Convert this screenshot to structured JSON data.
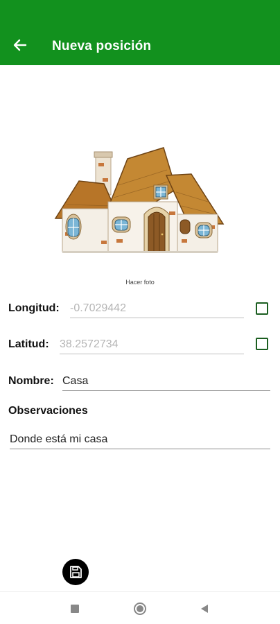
{
  "toolbar": {
    "title": "Nueva posición",
    "back_icon": "arrow-back-icon",
    "color": "#12911e"
  },
  "photo": {
    "caption": "Hacer foto",
    "image_subject": "cartoon-house"
  },
  "form": {
    "longitude": {
      "label": "Longitud:",
      "hint": "-0.7029442",
      "checked": false
    },
    "latitude": {
      "label": "Latitud:",
      "hint": "38.2572734",
      "checked": false
    },
    "name": {
      "label": "Nombre:",
      "value": "Casa"
    },
    "notes": {
      "label": "Observaciones",
      "value": "Donde está mi casa"
    }
  },
  "actions": {
    "save_icon": "save-icon"
  },
  "system_nav": {
    "recents_icon": "square-icon",
    "home_icon": "circle-icon",
    "back_icon": "triangle-back-icon"
  }
}
